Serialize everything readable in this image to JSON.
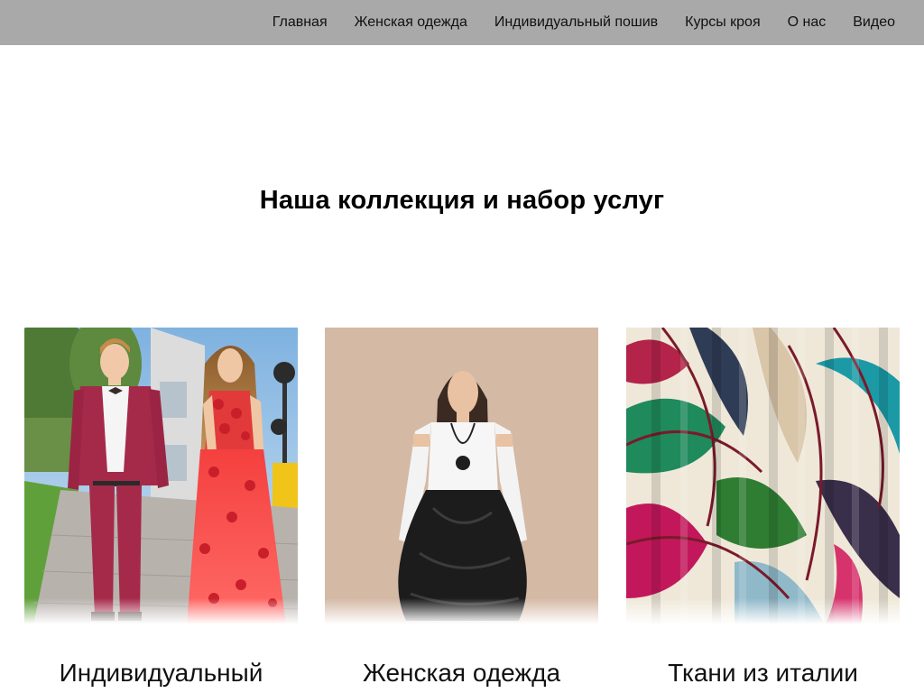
{
  "nav": {
    "items": [
      {
        "label": "Главная"
      },
      {
        "label": "Женская одежда"
      },
      {
        "label": "Индивидуальный пошив"
      },
      {
        "label": "Курсы кроя"
      },
      {
        "label": "О нас"
      },
      {
        "label": "Видео"
      }
    ]
  },
  "section": {
    "title": "Наша коллекция и набор услуг"
  },
  "cards": [
    {
      "caption": "Индивидуальный"
    },
    {
      "caption": "Женская одежда"
    },
    {
      "caption": "Ткани из италии"
    }
  ],
  "colors": {
    "nav_background": "#a9a9a9",
    "page_background": "#ffffff",
    "text": "#111111"
  }
}
